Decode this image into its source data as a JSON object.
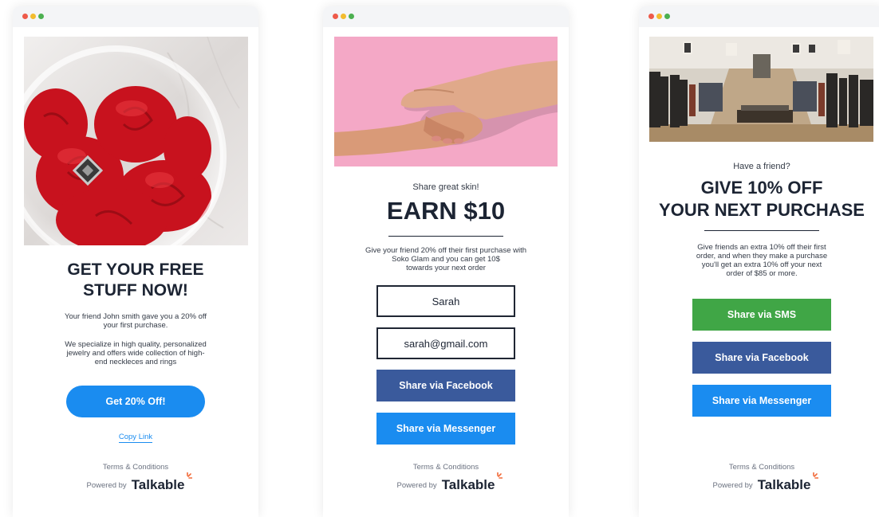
{
  "colors": {
    "dot_red": "#ee5a4a",
    "dot_yellow": "#f3bc2e",
    "dot_green": "#4cb050",
    "accent_blue": "#1a8cf0",
    "facebook": "#3a5a9c",
    "messenger": "#1a8cf0",
    "sms": "#40a646",
    "brand_spark": "#f26b3a"
  },
  "cards": [
    {
      "headline_line1": "GET YOUR FREE",
      "headline_line2": "STUFF NOW!",
      "body_line1": "Your friend John smith gave you a 20% off",
      "body_line2": "your first purchase.",
      "body2_line1": "We specialize in high  quality, personalized",
      "body2_line2": "jewelry and offers wide collection of high-",
      "body2_line3": "end neckleces and rings",
      "cta_label": "Get 20% Off!",
      "copy_link_label": "Copy Link",
      "terms_label": "Terms & Conditions",
      "powered_label": "Powered by",
      "brand": "Talkable"
    },
    {
      "eyebrow": "Share great skin!",
      "headline": "EARN $10",
      "body_line1": "Give your friend 20% off their first purchase with",
      "body_line2": "Soko Glam and you can get 10$",
      "body_line3": "towards your next order",
      "name_value": "Sarah",
      "email_value": "sarah@gmail.com",
      "facebook_label": "Share via Facebook",
      "messenger_label": "Share via Messenger",
      "terms_label": "Terms & Conditions",
      "powered_label": "Powered by",
      "brand": "Talkable"
    },
    {
      "eyebrow": "Have a friend?",
      "headline_line1": "GIVE 10% OFF",
      "headline_line2": "YOUR NEXT PURCHASE",
      "body_line1": "Give friends an extra 10% off their first",
      "body_line2": "order, and when they make a purchase",
      "body_line3": "you'll get an extra 10% off your next",
      "body_line4": "order of $85 or more.",
      "sms_label": "Share via SMS",
      "facebook_label": "Share via Facebook",
      "messenger_label": "Share via Messenger",
      "terms_label": "Terms & Conditions",
      "powered_label": "Powered by",
      "brand": "Talkable"
    }
  ]
}
